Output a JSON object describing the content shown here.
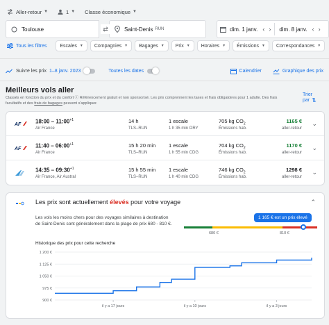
{
  "top_selects": {
    "trip_type": "Aller-retour",
    "passengers": "1",
    "cabin": "Classe économique"
  },
  "search": {
    "origin": "Toulouse",
    "destination": "Saint-Denis",
    "destination_code": "RUN",
    "depart_date": "dim. 1 janv.",
    "return_date": "dim. 8 janv."
  },
  "filters": {
    "all_label": "Tous les filtres",
    "chips": [
      "Escales",
      "Compagnies",
      "Bagages",
      "Prix",
      "Horaires",
      "Émissions",
      "Correspondances"
    ]
  },
  "tracking": {
    "label": "Suivre les prix",
    "date_range": "1–8 janv. 2023",
    "all_dates": "Toutes les dates",
    "calendar": "Calendrier",
    "price_graph": "Graphique des prix"
  },
  "best": {
    "title": "Meilleurs vols aller",
    "note_1": "Classés en fonction du prix et du confort",
    "note_2": " Référencement gratuit et non sponsorisé. Les prix comprennent les taxes et frais obligatoires pour 1 adulte. Des frais facultatifs et des ",
    "note_link": "frais de bagages",
    "note_3": " peuvent s'appliquer.",
    "sort_label_1": "Trier",
    "sort_label_2": "par"
  },
  "flights": [
    {
      "logo": "af",
      "times": "18:00 – 11:00",
      "plus_day": "+1",
      "airline": "Air France",
      "duration": "14 h",
      "route": "TLS–RUN",
      "stops": "1 escale",
      "layover": "1 h 35 min ORY",
      "co2": "705 kg CO",
      "co2_sub": "2",
      "emissions": "Émissions hab.",
      "price": "1165 €",
      "price_label": "aller-retour",
      "green": true
    },
    {
      "logo": "af",
      "times": "11:40 – 06:00",
      "plus_day": "+1",
      "airline": "Air France",
      "duration": "15 h 20 min",
      "route": "TLS–RUN",
      "stops": "1 escale",
      "layover": "1 h 55 min CDG",
      "co2": "704 kg CO",
      "co2_sub": "2",
      "emissions": "Émissions hab.",
      "price": "1170 €",
      "price_label": "aller-retour",
      "green": true
    },
    {
      "logo": "austral",
      "times": "14:35 – 09:30",
      "plus_day": "+1",
      "airline": "Air France, Air Austral",
      "duration": "15 h 55 min",
      "route": "TLS–RUN",
      "stops": "1 escale",
      "layover": "1 h 40 min CDG",
      "co2": "746 kg CO",
      "co2_sub": "2",
      "emissions": "Émissions hab.",
      "price": "1298 €",
      "price_label": "aller-retour",
      "green": false
    }
  ],
  "insights": {
    "head_1": "Les prix sont actuellement ",
    "head_high": "élevés",
    "head_2": " pour votre voyage",
    "text": "Les vols les moins chers pour des voyages similaires à destination de Saint-Denis sont généralement dans la plage de prix 680 - 810 €.",
    "badge": "1 165 € est un prix élevé",
    "range_low": "680 €",
    "range_high": "810 €",
    "history_title": "Historique des prix pour cette recherche"
  },
  "chart_data": {
    "type": "line",
    "title": "Historique des prix pour cette recherche",
    "y_ticks": [
      "1 200 €",
      "1 125 €",
      "1 050 €",
      "975 €",
      "900 €"
    ],
    "ylim": [
      900,
      1200
    ],
    "x_ticks": [
      "il y a 17 jours",
      "il y a 10 jours",
      "il y a 3 jours"
    ],
    "x": [
      -22,
      -20,
      -18,
      -17,
      -16,
      -15,
      -14,
      -13,
      -12,
      -11,
      -10,
      -9,
      -8,
      -7,
      -6,
      -5,
      -4,
      -3,
      -2,
      -1,
      0
    ],
    "series": [
      {
        "values": [
          942,
          942,
          942,
          958,
          958,
          982,
          982,
          1010,
          1030,
          1030,
          1104,
          1104,
          1104,
          1114,
          1133,
          1133,
          1133,
          1150,
          1150,
          1150,
          1165
        ]
      }
    ],
    "grid": true,
    "color": "#1a73e8"
  },
  "colors": {
    "accent": "#1a73e8",
    "good_price": "#188038",
    "high": "#d93025",
    "mid": "#fbbc04"
  }
}
